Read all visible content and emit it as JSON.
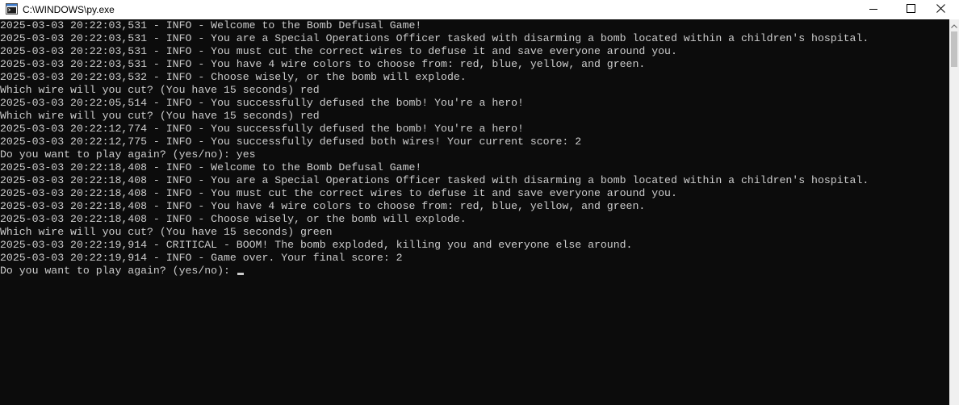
{
  "window": {
    "title": "C:\\WINDOWS\\py.exe",
    "icons": {
      "app": "console-app-icon",
      "minimize": "minimize-icon",
      "maximize": "maximize-icon",
      "close": "close-icon",
      "scroll_up": "chevron-up-icon"
    }
  },
  "console": {
    "lines": [
      "2025-03-03 20:22:03,531 - INFO - Welcome to the Bomb Defusal Game!",
      "2025-03-03 20:22:03,531 - INFO - You are a Special Operations Officer tasked with disarming a bomb located within a children's hospital.",
      "2025-03-03 20:22:03,531 - INFO - You must cut the correct wires to defuse it and save everyone around you.",
      "2025-03-03 20:22:03,531 - INFO - You have 4 wire colors to choose from: red, blue, yellow, and green.",
      "2025-03-03 20:22:03,532 - INFO - Choose wisely, or the bomb will explode.",
      "Which wire will you cut? (You have 15 seconds) red",
      "2025-03-03 20:22:05,514 - INFO - You successfully defused the bomb! You're a hero!",
      "Which wire will you cut? (You have 15 seconds) red",
      "2025-03-03 20:22:12,774 - INFO - You successfully defused the bomb! You're a hero!",
      "2025-03-03 20:22:12,775 - INFO - You successfully defused both wires! Your current score: 2",
      "Do you want to play again? (yes/no): yes",
      "2025-03-03 20:22:18,408 - INFO - Welcome to the Bomb Defusal Game!",
      "2025-03-03 20:22:18,408 - INFO - You are a Special Operations Officer tasked with disarming a bomb located within a children's hospital.",
      "2025-03-03 20:22:18,408 - INFO - You must cut the correct wires to defuse it and save everyone around you.",
      "2025-03-03 20:22:18,408 - INFO - You have 4 wire colors to choose from: red, blue, yellow, and green.",
      "2025-03-03 20:22:18,408 - INFO - Choose wisely, or the bomb will explode.",
      "Which wire will you cut? (You have 15 seconds) green",
      "2025-03-03 20:22:19,914 - CRITICAL - BOOM! The bomb exploded, killing you and everyone else around.",
      "2025-03-03 20:22:19,914 - INFO - Game over. Your final score: 2"
    ],
    "prompt": "Do you want to play again? (yes/no): "
  },
  "colors": {
    "console_background": "#0c0c0c",
    "console_text": "#cccccc",
    "titlebar_background": "#ffffff"
  }
}
